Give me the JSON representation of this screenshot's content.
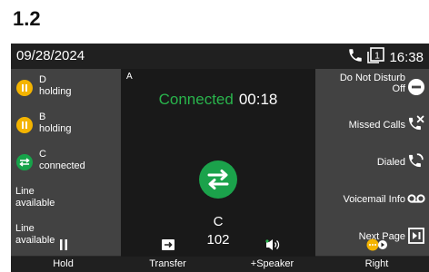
{
  "section": {
    "label": "1.2"
  },
  "status": {
    "date": "09/28/2024",
    "time": "16:38",
    "line_number": "1"
  },
  "lines": [
    {
      "name": "D",
      "state": "holding",
      "type": "hold"
    },
    {
      "name": "B",
      "state": "holding",
      "type": "hold"
    },
    {
      "name": "C",
      "state": "connected",
      "type": "connected"
    },
    {
      "name": "Line",
      "state": "available",
      "type": "available"
    },
    {
      "name": "Line",
      "state": "available",
      "type": "available"
    }
  ],
  "call": {
    "line_letter": "A",
    "status": "Connected",
    "timer": "00:18",
    "caller_name": "C",
    "caller_number": "102"
  },
  "softkeys": [
    {
      "label_line1": "Do Not Disturb",
      "label_line2": "Off",
      "icon": "do-not-disturb-icon"
    },
    {
      "label_line1": "Missed Calls",
      "label_line2": "",
      "icon": "missed-calls-icon"
    },
    {
      "label_line1": "Dialed",
      "label_line2": "",
      "icon": "dialed-calls-icon"
    },
    {
      "label_line1": "Voicemail Info",
      "label_line2": "",
      "icon": "voicemail-icon"
    },
    {
      "label_line1": "Next Page",
      "label_line2": "",
      "icon": "next-page-icon"
    }
  ],
  "bottom": [
    {
      "label": "Hold",
      "icon": "hold-icon"
    },
    {
      "label": "Transfer",
      "icon": "transfer-icon"
    },
    {
      "label": "+Speaker",
      "icon": "speaker-icon"
    },
    {
      "label": "Right",
      "icon": "more-right-icon"
    }
  ],
  "colors": {
    "connected": "#29b44c",
    "hold": "#f4b400",
    "call_icon": "#1ba24b"
  }
}
